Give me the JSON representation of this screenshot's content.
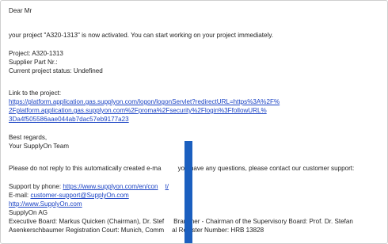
{
  "email": {
    "greeting": "Dear Mr",
    "activation_text": "your project \"A320-1313\" is now activated. You can start working on your project immediately.",
    "project_line": "Project: A320-1313",
    "supplier_part_line": "Supplier Part Nr.:",
    "status_line": "Current project status: Undefined",
    "link_label": "Link to the project:",
    "link_lines": [
      "https://platform.application.gas.supplyon.com/logon/logonServlet?redirectURL=https%3A%2F%",
      "2Fplatform.application.gas.supplyon.com%2Fproma%2Fsecurity%2Flogin%3FfollowURL%",
      "3Da4f505586aae044ab7dac57eb9177a23"
    ],
    "closing": "Best regards,",
    "signature": "Your SupplyOn Team",
    "notice_before": "Please do not reply to this automatically created e-ma",
    "notice_after": "you have any questions, please contact our customer support:",
    "support_phone_label": "Support by phone: ",
    "support_phone_link": "https://www.supplyon.com/en/con",
    "support_phone_link_tail": "t/",
    "email_label": "E-mail: ",
    "email_link": "customer-support@SupplyOn.com",
    "website_link": "http://www.SupplyOn.com",
    "company": "SupplyOn AG",
    "board_before": "Executive Board: Markus Quicken (Chairman), Dr. Stef",
    "board_after": "Brandner - Chairman of the Supervisory Board: Prof. Dr. Stefan",
    "registration_before": "Asenkerschbaumer Registration Court: Munich, Comm",
    "registration_after": "al Register Number: HRB 13828"
  },
  "colors": {
    "link": "#1b43c4",
    "text": "#1f1f1f",
    "overlay_bar": "#1b5fbf"
  }
}
